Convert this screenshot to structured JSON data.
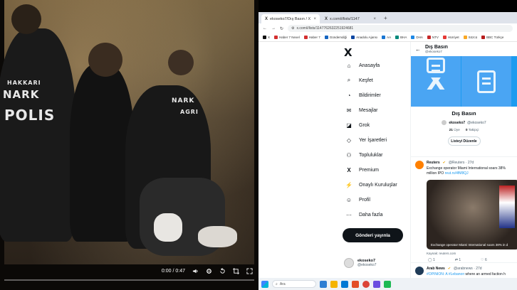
{
  "video": {
    "time": "0:00 / 0:47",
    "vest_left_top": "HAKKARI",
    "vest_left_main": "NARK",
    "vest_left_bottom": "POLIS",
    "vest_center": "NARK",
    "vest_center_city": "AGRI"
  },
  "browser": {
    "tabs": [
      {
        "label": "ekoseko7/Dış Basın / X",
        "active": true
      },
      {
        "label": "x.com/i/lists/1147",
        "active": false
      }
    ],
    "new_tab": "+",
    "url": "x.com/i/lists/1147762632251924681",
    "bookmarks": [
      "X",
      "Haber 7 Nexel",
      "Haber 7",
      "Gündemdiği",
      "Anadolu Ajansı",
      "AA",
      "BHA",
      "DHA",
      "NTV",
      "Hürriyet",
      "Sözcü",
      "BBC Türkçe"
    ],
    "bookmark_colors": [
      "#111111",
      "#d32f2f",
      "#d32f2f",
      "#1565c0",
      "#0d47a1",
      "#1976d2",
      "#00897b",
      "#1e88e5",
      "#c62828",
      "#e53935",
      "#f9a825",
      "#b71c1c"
    ]
  },
  "x": {
    "logo": "X",
    "nav": [
      {
        "label": "Anasayfa",
        "icon": "home-icon",
        "glyph": "⌂"
      },
      {
        "label": "Keşfet",
        "icon": "search-icon",
        "glyph": "⌕"
      },
      {
        "label": "Bildirimler",
        "icon": "bell-icon",
        "glyph": "◔"
      },
      {
        "label": "Mesajlar",
        "icon": "mail-icon",
        "glyph": "✉"
      },
      {
        "label": "Grok",
        "icon": "grok-icon",
        "glyph": "◪"
      },
      {
        "label": "Yer İşaretleri",
        "icon": "bookmark-icon",
        "glyph": "◇"
      },
      {
        "label": "Topluluklar",
        "icon": "communities-icon",
        "glyph": "⚇"
      },
      {
        "label": "Premium",
        "icon": "premium-x-icon",
        "glyph": "X"
      },
      {
        "label": "Onaylı Kuruluşlar",
        "icon": "verified-orgs-icon",
        "glyph": "⚡"
      },
      {
        "label": "Profil",
        "icon": "profile-icon",
        "glyph": "☺"
      },
      {
        "label": "Daha fazla",
        "icon": "more-icon",
        "glyph": "⋯"
      }
    ],
    "post_button": "Gönderi yayınla",
    "account": {
      "name": "ekoseko7",
      "handle": "@ekoseko7"
    },
    "list": {
      "header_title": "Dış Basın",
      "header_sub": "@ekoseko7",
      "name": "Dış Basın",
      "owner_name": "ekoseko7",
      "owner_handle": "@ekoseko7",
      "members_count": "21",
      "members_label": "Üye",
      "followers_count": "0",
      "followers_label": "Takipçi",
      "edit_button": "Listeyi Düzenle"
    },
    "tweets": [
      {
        "author": "Reuters",
        "meta": "@Reuters · 27d",
        "body_line1": "Exchange operator Miami International soars 38%",
        "body_line2_prefix": "million IPO ",
        "link": "reut.rs/4fM8QJ",
        "media_caption": "Exchange operator Miami International soars 38% in d",
        "media_source": "Kaynak: reuters.com",
        "actions": [
          "1",
          "1",
          "6"
        ],
        "avatar_color": "#ff8000"
      },
      {
        "author": "Arab News",
        "meta": "@arabnews · 27d",
        "body_prefix": "#OPINION: A ",
        "body_tag": "#Lebanon",
        "body_suffix": " where an armed faction h",
        "avatar_color": "#1f3b57"
      }
    ]
  },
  "taskbar": {
    "search_placeholder": "Ara"
  }
}
